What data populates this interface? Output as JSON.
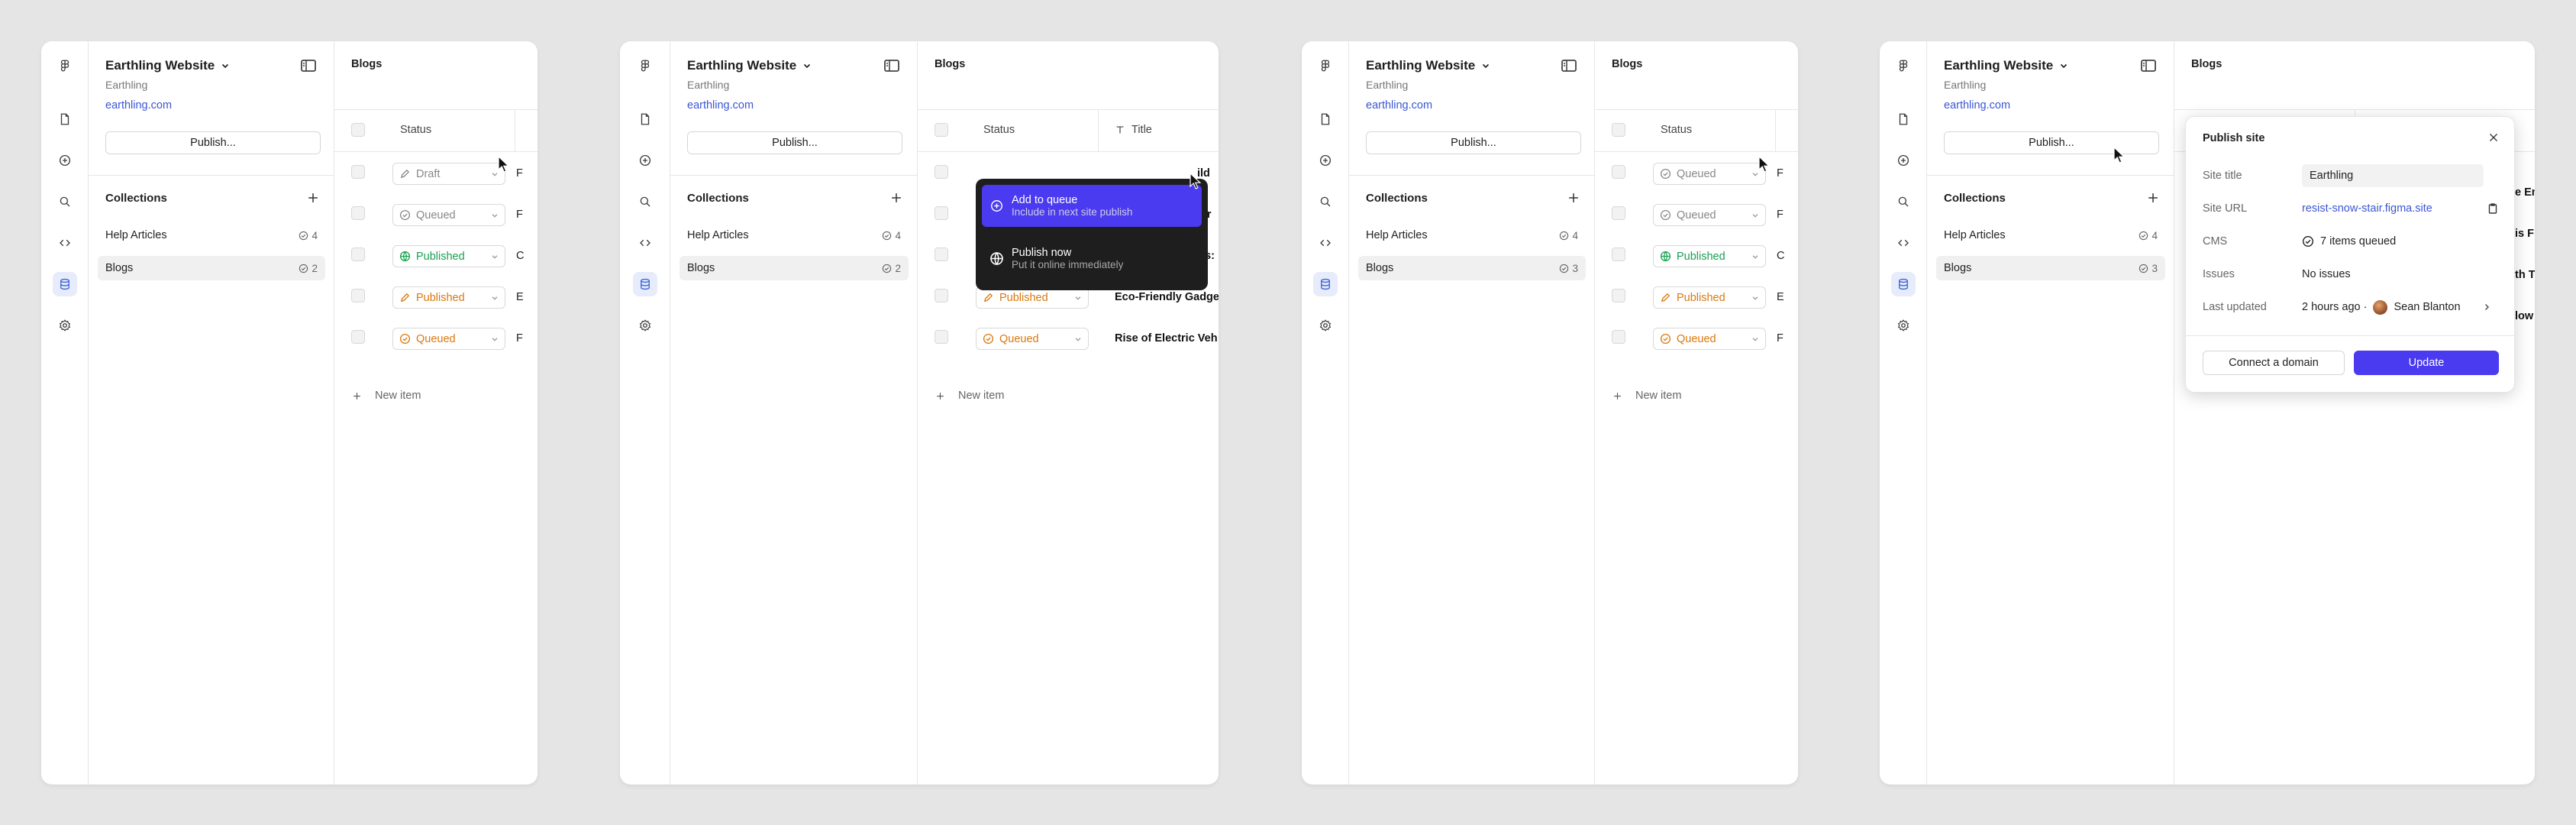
{
  "site": {
    "name": "Earthling Website",
    "subtitle": "Earthling",
    "url": "earthling.com",
    "publish_label": "Publish..."
  },
  "collections": {
    "heading": "Collections",
    "help_label": "Help Articles",
    "help_count": "4",
    "blogs_label": "Blogs"
  },
  "blog_counts": [
    "2",
    "2",
    "3",
    "3"
  ],
  "main": {
    "title": "Blogs",
    "status_header": "Status",
    "title_header": "Title",
    "new_item": "New item"
  },
  "status_labels": {
    "draft": "Draft",
    "queued": "Queued",
    "published": "Published"
  },
  "panel1_titles": [
    "F",
    "F",
    "C",
    "E",
    "F"
  ],
  "panel2_titles": [
    "ild",
    "ter",
    "s:",
    "Eco-Friendly Gadge",
    "Rise of Electric Veh"
  ],
  "panel3_titles": [
    "F",
    "F",
    "C",
    "E",
    "F"
  ],
  "panel4_titles": [
    "e En",
    "is F",
    "",
    "th T",
    "low"
  ],
  "menu": {
    "queue_title": "Add to queue",
    "queue_sub": "Include in next site publish",
    "now_title": "Publish now",
    "now_sub": "Put it online immediately"
  },
  "publish_dialog": {
    "title": "Publish site",
    "site_title_label": "Site title",
    "site_title_value": "Earthling",
    "site_url_label": "Site URL",
    "site_url_value": "resist-snow-stair.figma.site",
    "cms_label": "CMS",
    "cms_value": "7 items queued",
    "issues_label": "Issues",
    "issues_value": "No issues",
    "updated_label": "Last updated",
    "updated_value": "2 hours ago ·",
    "updated_user": "Sean Blanton",
    "connect_label": "Connect a domain",
    "update_label": "Update"
  },
  "colors": {
    "accent": "#4a3af0",
    "link": "#3a56d4",
    "published": "#18a050",
    "queued": "#d9780f"
  }
}
